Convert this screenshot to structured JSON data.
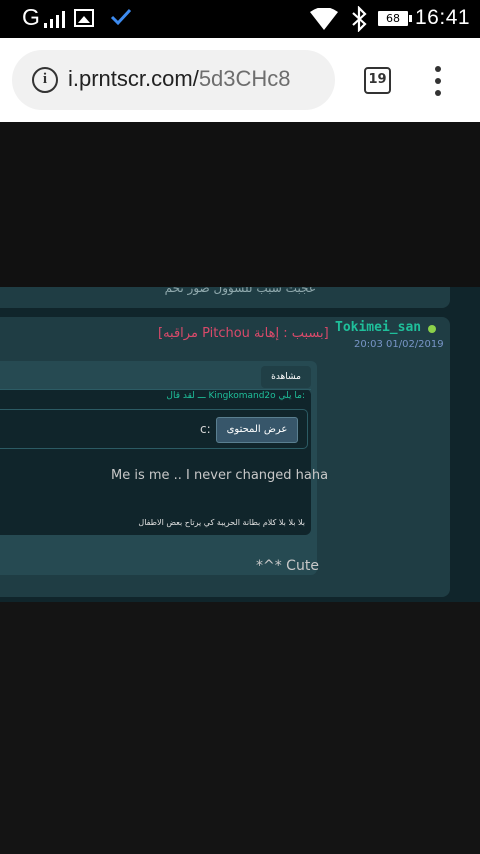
{
  "status_bar": {
    "carrier": "G",
    "battery": "68",
    "time": "16:41"
  },
  "browser": {
    "url_host": "i.prntscr.com/",
    "url_path": "5d3CHc8",
    "tab_count": "19"
  },
  "forum": {
    "prev_post_fragment": "عجبت سبب للسؤول صور تحم",
    "post": {
      "username": "Tokimei_san",
      "date": "20:03 01/02/2019",
      "edit_note": "[مراقبه Pitchou بسبب : إهانة]",
      "view_label": "مشاهدة",
      "quote_author": "ـــ لقد قال Kingkomand2o ما يلي:",
      "quote_c_text": "c:",
      "show_content_button": "عرض المحتوى",
      "quote_body": "Me is me .. I never changed haha",
      "quote_signature": "بلا بلا بلا كلام بطانة الحريبة كي يرتاح بعض الاطفال",
      "post_text": "*^* Cute"
    }
  },
  "colors": {
    "forum_bg": "#10252b",
    "post_bg": "#1f3d44",
    "username": "#1fbf9a",
    "edit_note": "#d94a6a",
    "date": "#7895c7"
  },
  "icons": [
    "signal-icon",
    "image-icon",
    "check-icon",
    "wifi-icon",
    "bluetooth-icon",
    "battery-icon",
    "info-icon",
    "tab-switcher-icon",
    "more-menu-icon"
  ]
}
